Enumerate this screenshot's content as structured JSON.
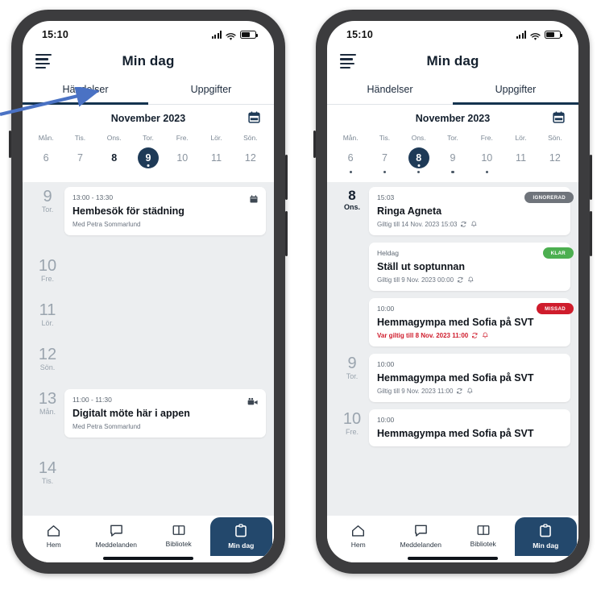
{
  "colors": {
    "navy": "#1e3a57",
    "nav_active": "#23486c",
    "badge_gray": "#6f747b",
    "badge_green": "#49a css",
    "badge_red": "#cf1c2c",
    "arrow_blue": "#4a72c4",
    "list_bg": "#eceef0"
  },
  "status_bar": {
    "time": "15:10",
    "signal_icon": "signal-bars-icon",
    "wifi_icon": "wifi-icon",
    "battery_icon": "battery-icon"
  },
  "app": {
    "title": "Min dag",
    "menu_icon": "hamburger-menu-icon",
    "calendar_icon": "calendar-icon"
  },
  "tabs": [
    {
      "label": "Händelser"
    },
    {
      "label": "Uppgifter"
    }
  ],
  "calendar": {
    "month": "November 2023",
    "day_names": [
      "Mån.",
      "Tis.",
      "Ons.",
      "Tor.",
      "Fre.",
      "Lör.",
      "Sön."
    ],
    "days": [
      "6",
      "7",
      "8",
      "9",
      "10",
      "11",
      "12"
    ]
  },
  "phone_left": {
    "active_tab_index": 0,
    "selected_day_index": 3,
    "bold_day_index": 2,
    "dots": [
      false,
      false,
      false,
      false,
      false,
      false,
      false
    ],
    "rows": [
      {
        "day_num": "9",
        "day_name": "Tor.",
        "today": false,
        "card": {
          "time": "13:00 - 13:30",
          "title": "Hembesök för städning",
          "sub": "Med Petra Sommarlund",
          "icon": "calendar-icon"
        }
      },
      {
        "day_num": "10",
        "day_name": "Fre.",
        "today": false,
        "card": null
      },
      {
        "day_num": "11",
        "day_name": "Lör.",
        "today": false,
        "card": null
      },
      {
        "day_num": "12",
        "day_name": "Sön.",
        "today": false,
        "card": null
      },
      {
        "day_num": "13",
        "day_name": "Mån.",
        "today": false,
        "card": {
          "time": "11:00 - 11:30",
          "title": "Digitalt möte här i appen",
          "sub": "Med Petra Sommarlund",
          "icon": "video-camera-icon"
        }
      },
      {
        "day_num": "14",
        "day_name": "Tis.",
        "today": false,
        "card": null
      }
    ]
  },
  "phone_right": {
    "active_tab_index": 1,
    "selected_day_index": 2,
    "bold_day_index": 2,
    "dots": [
      true,
      true,
      true,
      true,
      true,
      false,
      false
    ],
    "rows": [
      {
        "day_num": "8",
        "day_name": "Ons.",
        "today": true,
        "card": {
          "time": "15:03",
          "title": "Ringa Agneta",
          "sub": "Giltig till 14 Nov. 2023 15:03",
          "overdue": false,
          "badge": {
            "text": "IGNORERAD",
            "color": "#6f747b"
          },
          "repeat_icon": "repeat-icon",
          "bell_icon": "bell-icon"
        }
      },
      {
        "day_num": "",
        "day_name": "",
        "today": false,
        "card": {
          "time": "Heldag",
          "title": "Ställ ut soptunnan",
          "sub": "Giltig till 9 Nov. 2023 00:00",
          "overdue": false,
          "badge": {
            "text": "KLAR",
            "color": "#4caf50"
          },
          "repeat_icon": "repeat-icon",
          "bell_icon": "bell-icon"
        }
      },
      {
        "day_num": "",
        "day_name": "",
        "today": false,
        "card": {
          "time": "10:00",
          "title": "Hemmagympa med Sofia på SVT",
          "sub": "Var giltig till 8 Nov. 2023 11:00",
          "overdue": true,
          "badge": {
            "text": "MISSAD",
            "color": "#cf1c2c"
          },
          "repeat_icon": "repeat-icon",
          "bell_icon": "bell-icon"
        }
      },
      {
        "day_num": "9",
        "day_name": "Tor.",
        "today": false,
        "card": {
          "time": "10:00",
          "title": "Hemmagympa med Sofia på SVT",
          "sub": "Giltig till 9 Nov. 2023 11:00",
          "overdue": false,
          "badge": null,
          "repeat_icon": "repeat-icon",
          "bell_icon": "bell-icon"
        }
      },
      {
        "day_num": "10",
        "day_name": "Fre.",
        "today": false,
        "card": {
          "time": "10:00",
          "title": "Hemmagympa med Sofia på SVT",
          "sub": "",
          "overdue": false,
          "badge": null
        }
      }
    ]
  },
  "bottom_nav": [
    {
      "label": "Hem",
      "icon": "home-icon",
      "active": false
    },
    {
      "label": "Meddelanden",
      "icon": "chat-bubble-icon",
      "active": false
    },
    {
      "label": "Bibliotek",
      "icon": "book-icon",
      "active": false
    },
    {
      "label": "Min dag",
      "icon": "clipboard-calendar-icon",
      "active": true
    }
  ],
  "annotation": {
    "arrow_icon": "blue-arrow-pointing-to-handelser-tab"
  }
}
